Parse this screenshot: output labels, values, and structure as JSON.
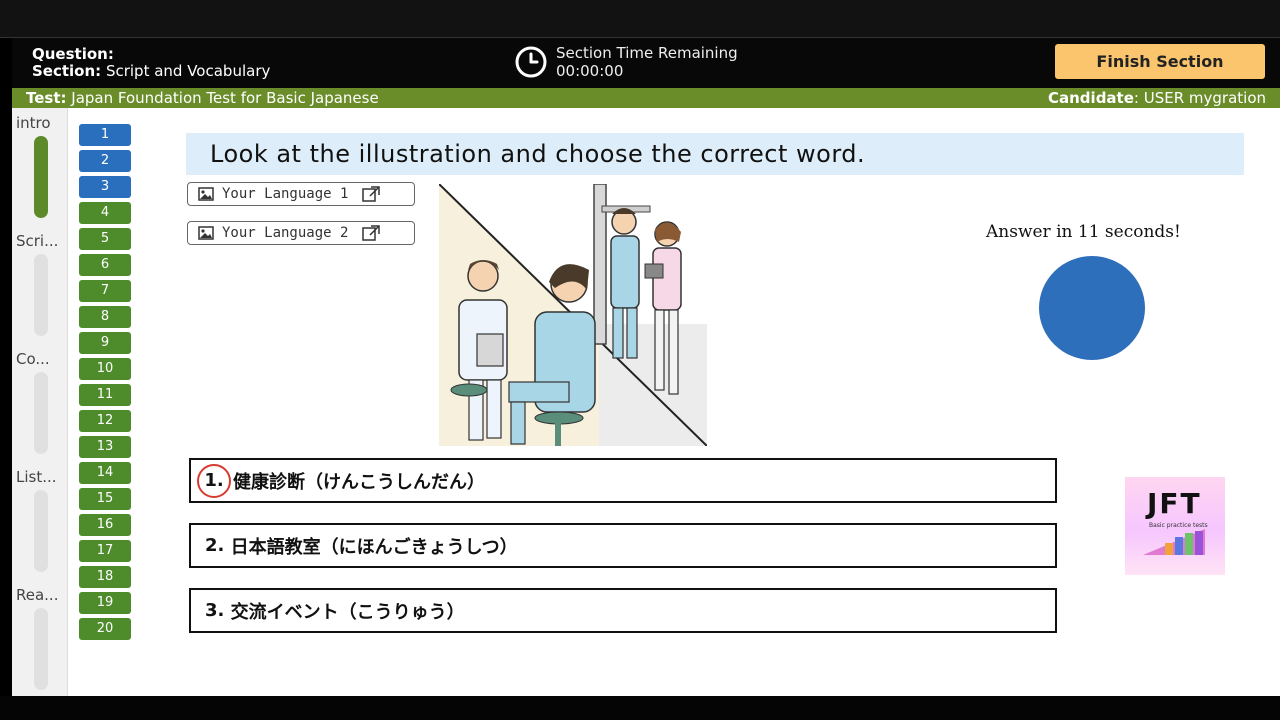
{
  "header": {
    "question_label": "Question:",
    "section_label": "Section:",
    "section_value": "Script and Vocabulary",
    "timer_title": "Section Time Remaining",
    "timer_value": "00:00:00",
    "finish_label": "Finish Section"
  },
  "subbar": {
    "test_label": "Test:",
    "test_value": "Japan Foundation Test for Basic Japanese",
    "candidate_label": "Candidate",
    "candidate_value": ": USER mygration"
  },
  "rail": {
    "sections": [
      "intro",
      "Scri...",
      "Co...",
      "List...",
      "Rea..."
    ]
  },
  "nav": {
    "questions": [
      "1",
      "2",
      "3",
      "4",
      "5",
      "6",
      "7",
      "8",
      "9",
      "10",
      "11",
      "12",
      "13",
      "14",
      "15",
      "16",
      "17",
      "18",
      "19",
      "20"
    ],
    "answered_count": 3
  },
  "main": {
    "instruction": "Look at the illustration and choose the correct word.",
    "lang1": "Your Language 1",
    "lang2": "Your Language 2",
    "answer_prompt": "Answer in 11 seconds!",
    "choices": [
      {
        "num": "1.",
        "text": "健康診断（けんこうしんだん）"
      },
      {
        "num": "2.",
        "text": "日本語教室（にほんごきょうしつ）"
      },
      {
        "num": "3.",
        "text": "交流イベント（こうりゅう）"
      }
    ]
  },
  "logo": {
    "title": "JFT",
    "subtitle": "Basic practice tests"
  },
  "colors": {
    "accent_green": "#6a8d2a",
    "answered_blue": "#2a6fbd",
    "finish_button": "#fbc56e",
    "countdown": "#2d6fba"
  }
}
